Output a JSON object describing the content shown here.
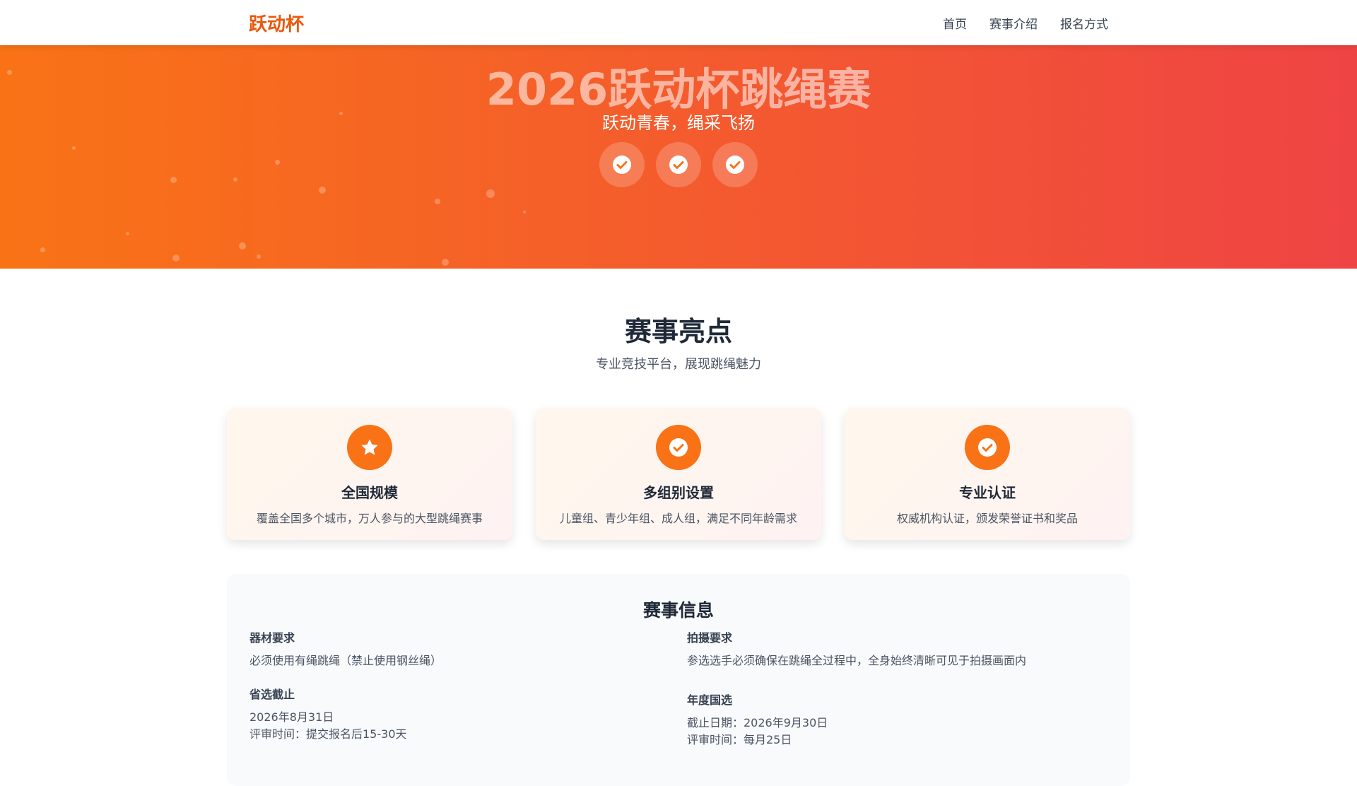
{
  "nav": {
    "logo": "跃动杯",
    "links": [
      "首页",
      "赛事介绍",
      "报名方式"
    ]
  },
  "hero": {
    "title": "2026跃动杯跳绳赛",
    "subtitle": "跃动青春，绳采飞扬",
    "badges": [
      "check-icon",
      "check-icon",
      "check-icon"
    ]
  },
  "highlights": {
    "title": "赛事亮点",
    "subtitle": "专业竞技平台，展现跳绳魅力",
    "cards": [
      {
        "icon": "star-icon",
        "title": "全国规模",
        "desc": "覆盖全国多个城市，万人参与的大型跳绳赛事"
      },
      {
        "icon": "check-icon",
        "title": "多组别设置",
        "desc": "儿童组、青少年组、成人组，满足不同年龄需求"
      },
      {
        "icon": "check-icon",
        "title": "专业认证",
        "desc": "权威机构认证，颁发荣誉证书和奖品"
      }
    ]
  },
  "info": {
    "title": "赛事信息",
    "items": [
      {
        "label": "器材要求",
        "lines": [
          "必须使用有绳跳绳（禁止使用钢丝绳）"
        ]
      },
      {
        "label": "拍摄要求",
        "lines": [
          "参选选手必须确保在跳绳全过程中，全身始终清晰可见于拍摄画面内"
        ]
      },
      {
        "label": "省选截止",
        "lines": [
          "2026年8月31日",
          "评审时间：提交报名后15-30天"
        ]
      },
      {
        "label": "年度国选",
        "lines": [
          "截止日期：2026年9月30日",
          "评审时间：每月25日"
        ]
      }
    ]
  },
  "colors": {
    "accent": "#f97316",
    "gradient_end": "#ef4444"
  }
}
